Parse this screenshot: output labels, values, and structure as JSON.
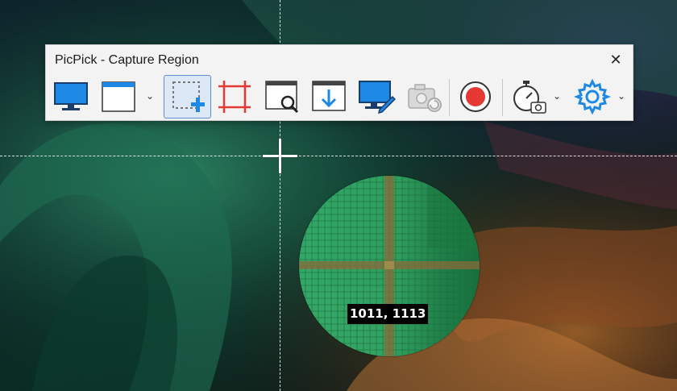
{
  "window": {
    "title": "PicPick - Capture Region"
  },
  "toolbar": {
    "close_label": "✕",
    "buttons": [
      {
        "name": "capture-fullscreen",
        "icon": "monitor-icon"
      },
      {
        "name": "capture-active-window",
        "icon": "window-icon",
        "dropdown": true
      },
      {
        "name": "capture-region",
        "icon": "region-select-icon",
        "active": true
      },
      {
        "name": "capture-fixed-region",
        "icon": "fixed-region-icon"
      },
      {
        "name": "capture-window-control",
        "icon": "window-search-icon"
      },
      {
        "name": "capture-scrolling-window",
        "icon": "scroll-window-icon"
      },
      {
        "name": "capture-freehand",
        "icon": "monitor-pen-icon"
      },
      {
        "name": "repeat-last-capture",
        "icon": "camera-repeat-icon",
        "disabled": true
      },
      {
        "name": "record-screen",
        "icon": "record-icon"
      },
      {
        "name": "timer-capture",
        "icon": "timer-camera-icon",
        "dropdown": true
      },
      {
        "name": "settings",
        "icon": "gear-icon",
        "dropdown": true
      }
    ],
    "caret": "⌄"
  },
  "magnifier": {
    "coordinates": "1011, 1113"
  },
  "colors": {
    "accent": "#1e88e5",
    "record": "#e53935",
    "region_red": "#e53935",
    "magnifier_green": "#2e9e5e"
  }
}
